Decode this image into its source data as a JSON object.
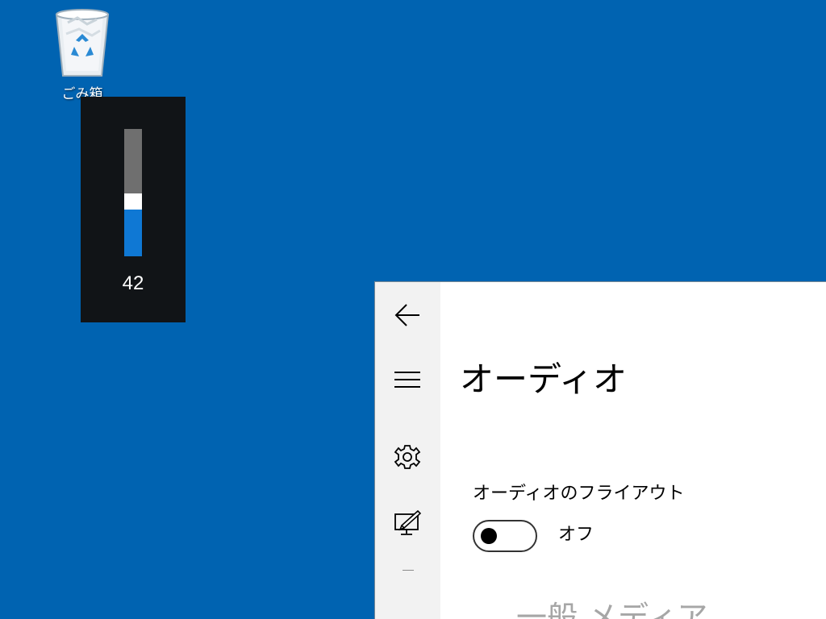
{
  "desktop": {
    "recycle_bin_label": "ごみ箱"
  },
  "volume_flyout": {
    "value_text": "42",
    "level_percent": 42
  },
  "settings": {
    "nav": {
      "back_icon": "back-arrow-icon",
      "menu_icon": "hamburger-menu-icon",
      "settings_icon": "gear-icon",
      "display_icon": "monitor-pen-icon"
    },
    "page_title": "オーディオ",
    "audio_flyout_label": "オーディオのフライアウト",
    "toggle_state": "オフ",
    "toggle_on": false,
    "section_heading": "一般 メディア"
  },
  "colors": {
    "desktop_bg": "#0063b1",
    "flyout_bg": "#111417",
    "accent": "#0f78d4"
  }
}
